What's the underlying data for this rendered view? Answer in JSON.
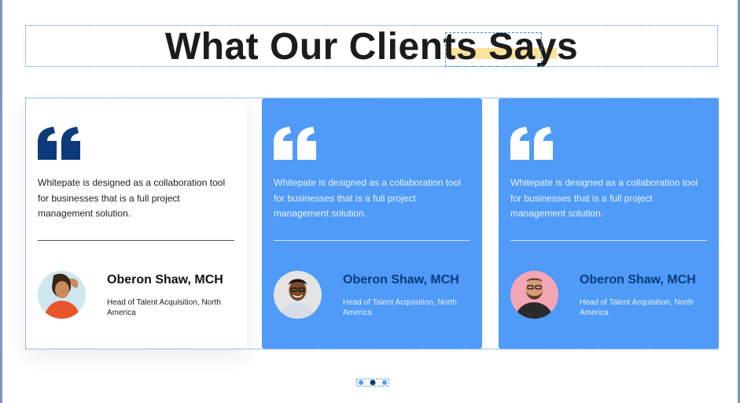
{
  "section": {
    "title_part1": "What Our Clien",
    "title_part2": "ts Say",
    "title_part3": "s"
  },
  "colors": {
    "card_blue": "#4f9bf7",
    "quote_dark": "#0d3a7a",
    "name_dark_blue": "#0b3a7e",
    "highlight": "#fbe29a",
    "selection_outline": "#3b8fe0"
  },
  "testimonials": [
    {
      "quote": "Whitepate is designed as a collaboration tool for businesses that is a full project management solution.",
      "name": "Oberon Shaw, MCH",
      "role": "Head of Talent Acquisition, North America",
      "avatar": "woman-avatar"
    },
    {
      "quote": "Whitepate is designed as a collaboration tool for businesses that is a full project management solution.",
      "name": "Oberon Shaw, MCH",
      "role": "Head of Talent Acquisition, North America",
      "avatar": "man-smiling-avatar"
    },
    {
      "quote": "Whitepate is designed as a collaboration tool for businesses that is a full project management solution.",
      "name": "Oberon Shaw, MCH",
      "role": "Head of Talent Acquisition, North America",
      "avatar": "bearded-man-avatar"
    }
  ],
  "pagination": {
    "count": 3,
    "active_index": 1
  }
}
